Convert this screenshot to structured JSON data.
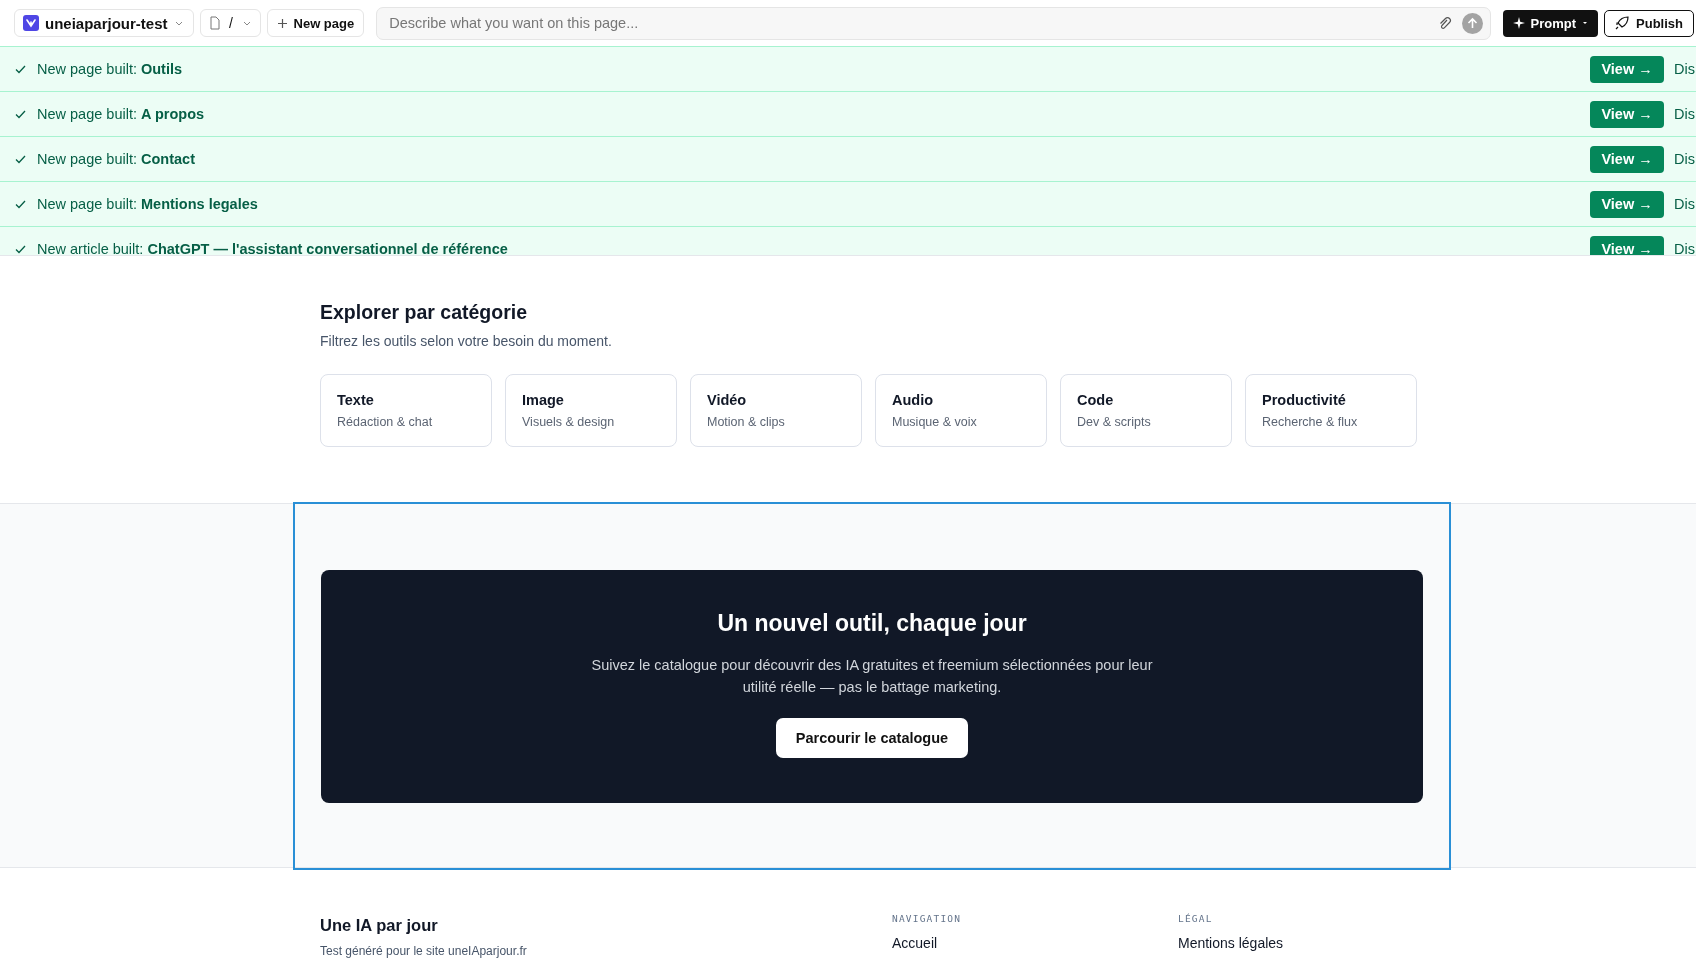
{
  "toolbar": {
    "project": "uneiaparjour-test",
    "page_path": "/",
    "new_page": "New page",
    "prompt_placeholder": "Describe what you want on this page...",
    "prompt_button": "Prompt",
    "publish_button": "Publish"
  },
  "notices": [
    {
      "prefix": "New page built:",
      "name": "Outils",
      "view": "View →",
      "dismiss": "Dis"
    },
    {
      "prefix": "New page built:",
      "name": "A propos",
      "view": "View →",
      "dismiss": "Dis"
    },
    {
      "prefix": "New page built:",
      "name": "Contact",
      "view": "View →",
      "dismiss": "Dis"
    },
    {
      "prefix": "New page built:",
      "name": "Mentions legales",
      "view": "View →",
      "dismiss": "Dis"
    },
    {
      "prefix": "New article built:",
      "name": "ChatGPT — l'assistant conversationnel de référence",
      "view": "View →",
      "dismiss": "Dis"
    }
  ],
  "categories": {
    "title": "Explorer par catégorie",
    "subtitle": "Filtrez les outils selon votre besoin du moment.",
    "items": [
      {
        "name": "Texte",
        "description": "Rédaction & chat"
      },
      {
        "name": "Image",
        "description": "Visuels & design"
      },
      {
        "name": "Vidéo",
        "description": "Motion & clips"
      },
      {
        "name": "Audio",
        "description": "Musique & voix"
      },
      {
        "name": "Code",
        "description": "Dev & scripts"
      },
      {
        "name": "Productivité",
        "description": "Recherche & flux"
      }
    ]
  },
  "cta": {
    "title": "Un nouvel outil, chaque jour",
    "text": "Suivez le catalogue pour découvrir des IA gratuites et freemium sélectionnées pour leur utilité réelle — pas le battage marketing.",
    "button": "Parcourir le catalogue"
  },
  "footer": {
    "brand": "Une IA par jour",
    "tagline": "Test généré pour le site uneIAparjour.fr",
    "columns": [
      {
        "heading": "NAVIGATION",
        "links": [
          "Accueil"
        ]
      },
      {
        "heading": "LÉGAL",
        "links": [
          "Mentions légales"
        ]
      }
    ]
  }
}
